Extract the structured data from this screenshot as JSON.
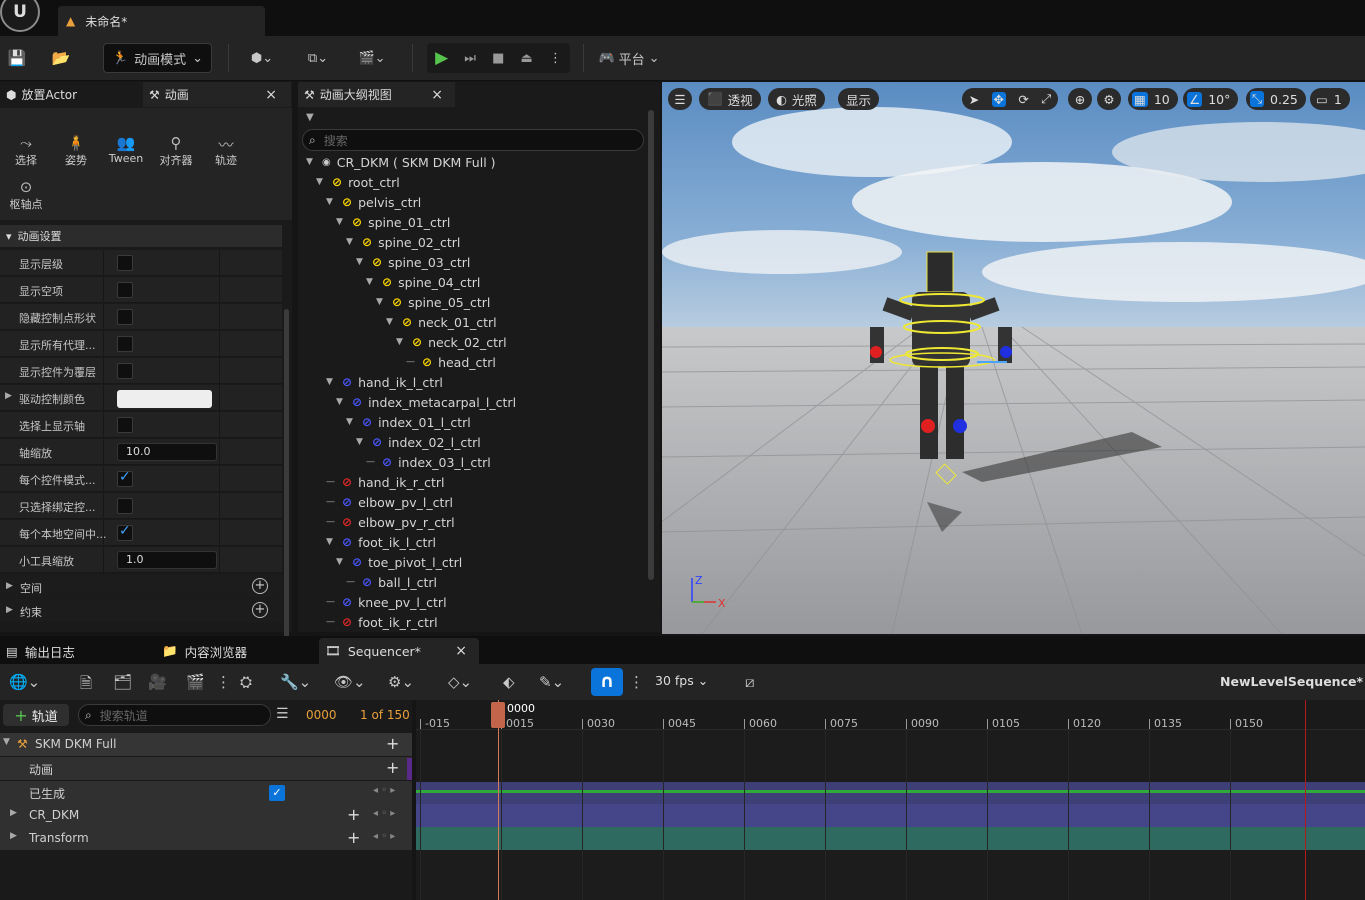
{
  "title": {
    "doc_tab": "未命名*"
  },
  "toolbar": {
    "mode": "动画模式",
    "platform": "平台"
  },
  "left_panel": {
    "tab1": "放置Actor",
    "tab2": "动画",
    "close": "×",
    "tools": [
      "选择",
      "姿势",
      "Tween",
      "对齐器",
      "轨迹",
      "枢轴点"
    ],
    "section": "动画设置",
    "props": [
      {
        "label": "显示层级",
        "type": "check",
        "checked": false
      },
      {
        "label": "显示空项",
        "type": "check",
        "checked": false
      },
      {
        "label": "隐藏控制点形状",
        "type": "check",
        "checked": false
      },
      {
        "label": "显示所有代理...",
        "type": "check",
        "checked": false
      },
      {
        "label": "显示控件为覆层",
        "type": "check",
        "checked": false
      },
      {
        "label": "驱动控制颜色",
        "type": "color",
        "value": ""
      },
      {
        "label": "选择上显示轴",
        "type": "check",
        "checked": false
      },
      {
        "label": "轴缩放",
        "type": "num",
        "value": "10.0"
      },
      {
        "label": "每个控件模式...",
        "type": "check",
        "checked": true
      },
      {
        "label": "只选择绑定控...",
        "type": "check",
        "checked": false
      },
      {
        "label": "每个本地空间中...",
        "type": "check",
        "checked": true
      },
      {
        "label": "小工具缩放",
        "type": "num",
        "value": "1.0"
      }
    ],
    "cats": [
      "空间",
      "约束"
    ]
  },
  "outliner": {
    "tab": "动画大纲视图",
    "close": "×",
    "search_placeholder": "搜索",
    "rows": [
      {
        "label": "CR_DKM ( SKM DKM Full )",
        "depth": 0,
        "color": "w"
      },
      {
        "label": "root_ctrl",
        "depth": 1,
        "color": "y"
      },
      {
        "label": "pelvis_ctrl",
        "depth": 2,
        "color": "y"
      },
      {
        "label": "spine_01_ctrl",
        "depth": 3,
        "color": "y"
      },
      {
        "label": "spine_02_ctrl",
        "depth": 4,
        "color": "y"
      },
      {
        "label": "spine_03_ctrl",
        "depth": 5,
        "color": "y"
      },
      {
        "label": "spine_04_ctrl",
        "depth": 6,
        "color": "y"
      },
      {
        "label": "spine_05_ctrl",
        "depth": 7,
        "color": "y"
      },
      {
        "label": "neck_01_ctrl",
        "depth": 8,
        "color": "y"
      },
      {
        "label": "neck_02_ctrl",
        "depth": 9,
        "color": "y"
      },
      {
        "label": "head_ctrl",
        "depth": 10,
        "color": "y"
      },
      {
        "label": "hand_ik_l_ctrl",
        "depth": 2,
        "color": "b"
      },
      {
        "label": "index_metacarpal_l_ctrl",
        "depth": 3,
        "color": "b"
      },
      {
        "label": "index_01_l_ctrl",
        "depth": 4,
        "color": "b"
      },
      {
        "label": "index_02_l_ctrl",
        "depth": 5,
        "color": "b"
      },
      {
        "label": "index_03_l_ctrl",
        "depth": 6,
        "color": "b"
      },
      {
        "label": "hand_ik_r_ctrl",
        "depth": 2,
        "color": "r"
      },
      {
        "label": "elbow_pv_l_ctrl",
        "depth": 2,
        "color": "b"
      },
      {
        "label": "elbow_pv_r_ctrl",
        "depth": 2,
        "color": "r"
      },
      {
        "label": "foot_ik_l_ctrl",
        "depth": 2,
        "color": "b"
      },
      {
        "label": "toe_pivot_l_ctrl",
        "depth": 3,
        "color": "b"
      },
      {
        "label": "ball_l_ctrl",
        "depth": 4,
        "color": "b"
      },
      {
        "label": "knee_pv_l_ctrl",
        "depth": 2,
        "color": "b"
      },
      {
        "label": "foot_ik_r_ctrl",
        "depth": 2,
        "color": "r"
      }
    ]
  },
  "viewport": {
    "perspective": "透视",
    "lighting": "光照",
    "show": "显示",
    "grid": "10",
    "angle": "10°",
    "scale": "0.25",
    "camera": "1",
    "axis_z": "Z",
    "axis_x": "X"
  },
  "bottom_tabs": {
    "output": "输出日志",
    "content": "内容浏览器",
    "sequencer": "Sequencer*",
    "close": "×"
  },
  "sequencer": {
    "fps": "30 fps",
    "sequence_name": "NewLevelSequence*",
    "add_track": "轨道",
    "search_placeholder": "搜索轨道",
    "current_frame": "0000",
    "frame_count": "1 of 150",
    "tracks": [
      {
        "label": "SKM DKM Full"
      },
      {
        "label": "动画"
      },
      {
        "label": "已生成"
      },
      {
        "label": "CR_DKM"
      },
      {
        "label": "Transform"
      }
    ],
    "playhead": "0000",
    "ticks": [
      "-015",
      "0015",
      "0030",
      "0045",
      "0060",
      "0075",
      "0090",
      "0105",
      "0120",
      "0135",
      "0150"
    ]
  }
}
